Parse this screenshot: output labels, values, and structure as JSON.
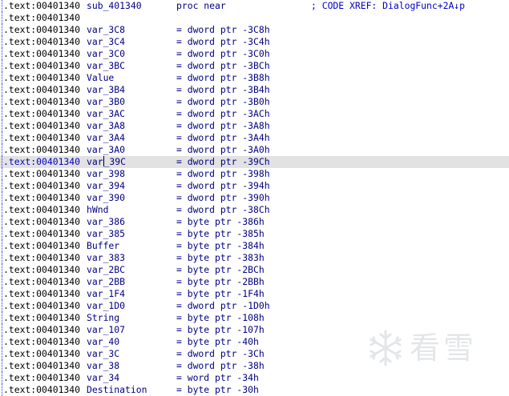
{
  "listing": [
    {
      "addr": ".text:00401340",
      "name": "sub_401340",
      "value": "proc near",
      "comment": "; CODE XREF: DialogFunc+2A↓p"
    },
    {
      "addr": ".text:00401340",
      "name": "",
      "value": "",
      "comment": ""
    },
    {
      "addr": ".text:00401340",
      "name": "var_3C8",
      "value": "= dword ptr -3C8h",
      "comment": ""
    },
    {
      "addr": ".text:00401340",
      "name": "var_3C4",
      "value": "= dword ptr -3C4h",
      "comment": ""
    },
    {
      "addr": ".text:00401340",
      "name": "var_3C0",
      "value": "= dword ptr -3C0h",
      "comment": ""
    },
    {
      "addr": ".text:00401340",
      "name": "var_3BC",
      "value": "= dword ptr -3BCh",
      "comment": ""
    },
    {
      "addr": ".text:00401340",
      "name": "Value",
      "value": "= dword ptr -3B8h",
      "comment": ""
    },
    {
      "addr": ".text:00401340",
      "name": "var_3B4",
      "value": "= dword ptr -3B4h",
      "comment": ""
    },
    {
      "addr": ".text:00401340",
      "name": "var_3B0",
      "value": "= dword ptr -3B0h",
      "comment": ""
    },
    {
      "addr": ".text:00401340",
      "name": "var_3AC",
      "value": "= dword ptr -3ACh",
      "comment": ""
    },
    {
      "addr": ".text:00401340",
      "name": "var_3A8",
      "value": "= dword ptr -3A8h",
      "comment": ""
    },
    {
      "addr": ".text:00401340",
      "name": "var_3A4",
      "value": "= dword ptr -3A4h",
      "comment": ""
    },
    {
      "addr": ".text:00401340",
      "name": "var_3A0",
      "value": "= dword ptr -3A0h",
      "comment": ""
    },
    {
      "addr": ".text:00401340",
      "name": "var_39C",
      "value": "= dword ptr -39Ch",
      "comment": "",
      "selected": true,
      "cursor_after": 3
    },
    {
      "addr": ".text:00401340",
      "name": "var_398",
      "value": "= dword ptr -398h",
      "comment": ""
    },
    {
      "addr": ".text:00401340",
      "name": "var_394",
      "value": "= dword ptr -394h",
      "comment": ""
    },
    {
      "addr": ".text:00401340",
      "name": "var_390",
      "value": "= dword ptr -390h",
      "comment": ""
    },
    {
      "addr": ".text:00401340",
      "name": "hWnd",
      "value": "= dword ptr -38Ch",
      "comment": ""
    },
    {
      "addr": ".text:00401340",
      "name": "var_386",
      "value": "= byte ptr -386h",
      "comment": ""
    },
    {
      "addr": ".text:00401340",
      "name": "var_385",
      "value": "= byte ptr -385h",
      "comment": ""
    },
    {
      "addr": ".text:00401340",
      "name": "Buffer",
      "value": "= byte ptr -384h",
      "comment": ""
    },
    {
      "addr": ".text:00401340",
      "name": "var_383",
      "value": "= byte ptr -383h",
      "comment": ""
    },
    {
      "addr": ".text:00401340",
      "name": "var_2BC",
      "value": "= byte ptr -2BCh",
      "comment": ""
    },
    {
      "addr": ".text:00401340",
      "name": "var_2BB",
      "value": "= byte ptr -2BBh",
      "comment": ""
    },
    {
      "addr": ".text:00401340",
      "name": "var_1F4",
      "value": "= byte ptr -1F4h",
      "comment": ""
    },
    {
      "addr": ".text:00401340",
      "name": "var_1D0",
      "value": "= dword ptr -1D0h",
      "comment": ""
    },
    {
      "addr": ".text:00401340",
      "name": "String",
      "value": "= byte ptr -108h",
      "comment": ""
    },
    {
      "addr": ".text:00401340",
      "name": "var_107",
      "value": "= byte ptr -107h",
      "comment": ""
    },
    {
      "addr": ".text:00401340",
      "name": "var_40",
      "value": "= byte ptr -40h",
      "comment": ""
    },
    {
      "addr": ".text:00401340",
      "name": "var_3C",
      "value": "= dword ptr -3Ch",
      "comment": ""
    },
    {
      "addr": ".text:00401340",
      "name": "var_38",
      "value": "= dword ptr -38h",
      "comment": ""
    },
    {
      "addr": ".text:00401340",
      "name": "var_34",
      "value": "= word ptr -34h",
      "comment": ""
    },
    {
      "addr": ".text:00401340",
      "name": "Destination",
      "value": "= byte ptr -30h",
      "comment": ""
    }
  ],
  "watermark": {
    "text": "看雪",
    "icon": "snowflake-icon"
  }
}
